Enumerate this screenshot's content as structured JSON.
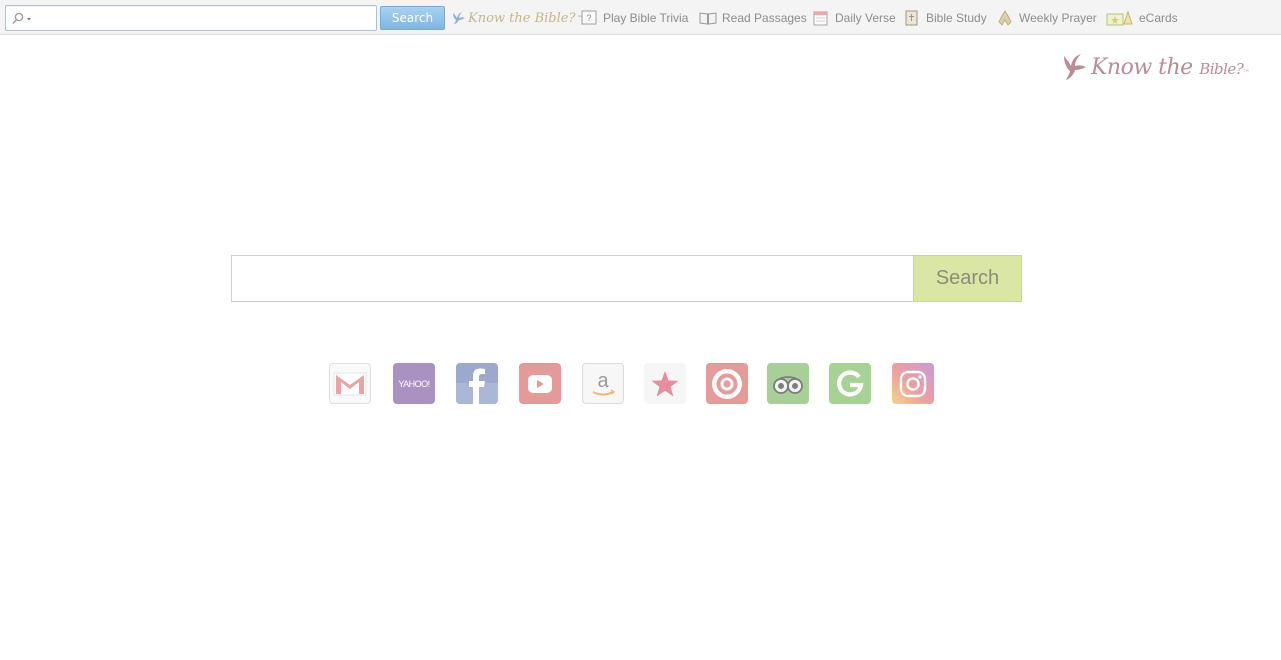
{
  "toolbar": {
    "search": {
      "value": "",
      "placeholder": ""
    },
    "search_button_label": "Search",
    "logo": {
      "text": "Know the Bible?",
      "tm": "™"
    },
    "links": [
      {
        "label": "Play Bible Trivia",
        "icon": "trivia-icon"
      },
      {
        "label": "Read Passages",
        "icon": "open-book-icon"
      },
      {
        "label": "Daily Verse",
        "icon": "calendar-icon"
      },
      {
        "label": "Bible Study",
        "icon": "bible-icon"
      },
      {
        "label": "Weekly Prayer",
        "icon": "praying-hands-icon"
      },
      {
        "label": "eCards",
        "icon": "ecard-icon"
      }
    ]
  },
  "brand": {
    "text_1": "Know the",
    "text_2": "Bible?",
    "tm": "™"
  },
  "main_search": {
    "value": "",
    "placeholder": "",
    "button_label": "Search"
  },
  "quick_links": [
    {
      "icon": "gmail-icon"
    },
    {
      "icon": "yahoo-icon",
      "text": "YAHOO!"
    },
    {
      "icon": "facebook-icon"
    },
    {
      "icon": "youtube-icon"
    },
    {
      "icon": "amazon-icon",
      "text": "a"
    },
    {
      "icon": "macys-star-icon"
    },
    {
      "icon": "target-icon"
    },
    {
      "icon": "tripadvisor-icon"
    },
    {
      "icon": "google-icon"
    },
    {
      "icon": "instagram-icon"
    }
  ],
  "colors": {
    "toolbar_bg": "#f4f4f4",
    "toolbar_search_btn": "#8fc2e8",
    "logo_gold": "#c7b48a",
    "brand_mauve": "#b88d96",
    "main_search_btn": "#d9e6a4",
    "yahoo": "#a992c2",
    "facebook": "#9aa9cc",
    "youtube": "#e29a9a",
    "target": "#e79a9a",
    "tripadvisor": "#a9cf98",
    "google": "#a6d393"
  }
}
